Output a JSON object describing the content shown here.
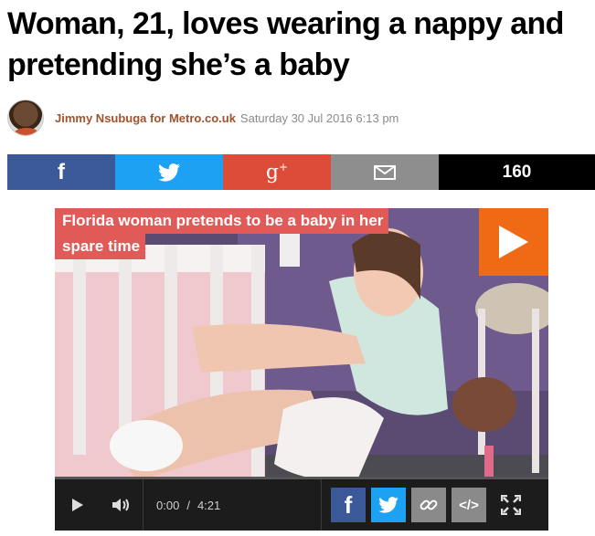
{
  "article": {
    "headline": "Woman, 21, loves wearing a nappy and pretending she’s a baby",
    "author": "Jimmy Nsubuga for Metro.co.uk",
    "date": "Saturday 30 Jul 2016 6:13 pm"
  },
  "share_bar": {
    "facebook_icon": "facebook-icon",
    "twitter_icon": "twitter-icon",
    "googleplus_icon": "google-plus-icon",
    "email_icon": "email-icon",
    "share_count": "160",
    "colors": {
      "facebook": "#3b5998",
      "twitter": "#1da1f2",
      "googleplus": "#dd4b39",
      "email": "#8e8e8e",
      "count": "#000000"
    }
  },
  "video": {
    "title": "Florida woman pretends to be a baby in her spare time",
    "title_line1": "Florida woman pretends to be a baby in her",
    "title_line2": "spare time",
    "play_icon": "play-icon",
    "current_time": "0:00",
    "separator": "/",
    "duration": "4:21",
    "progress": 0,
    "controls": {
      "play_icon": "play-icon",
      "volume_icon": "volume-icon",
      "facebook_icon": "facebook-icon",
      "twitter_icon": "twitter-icon",
      "link_icon": "link-icon",
      "embed_icon": "embed-icon",
      "embed_label": "</>",
      "fullscreen_icon": "fullscreen-icon"
    },
    "accent_color": "#f06a15"
  }
}
